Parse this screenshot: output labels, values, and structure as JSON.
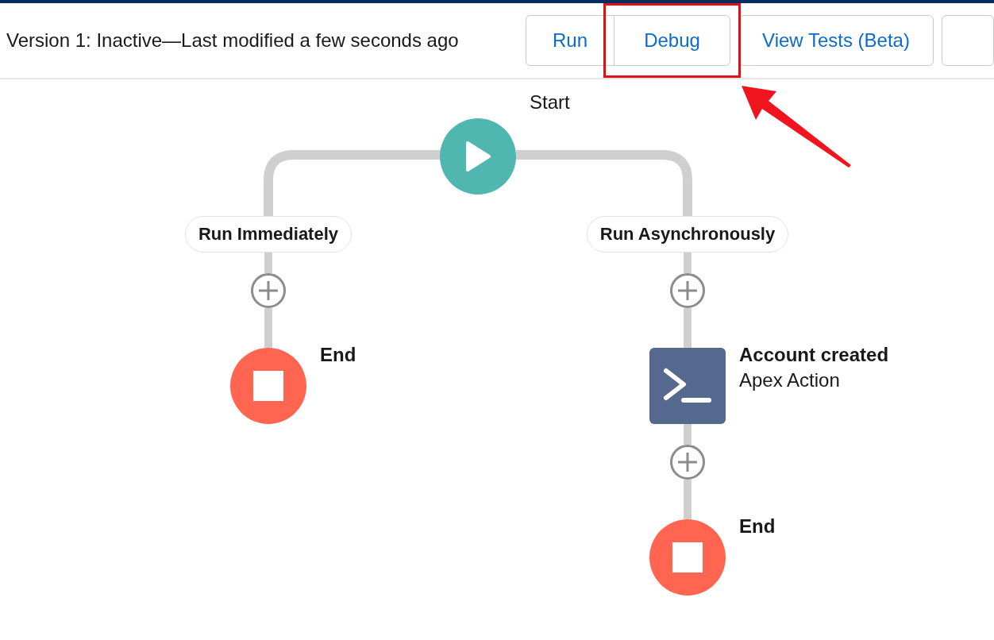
{
  "toolbar": {
    "version_status": "Version 1: Inactive—Last modified a few seconds ago",
    "buttons": [
      {
        "label": "Run",
        "highlighted": false
      },
      {
        "label": "Debug",
        "highlighted": true
      },
      {
        "label": "View Tests (Beta)",
        "highlighted": false
      }
    ]
  },
  "flow": {
    "start": {
      "label": "Start"
    },
    "branches": [
      {
        "label": "Run Immediately",
        "elements": [
          {
            "kind": "end",
            "label": "End"
          }
        ]
      },
      {
        "label": "Run Asynchronously",
        "elements": [
          {
            "kind": "action",
            "title": "Account created",
            "subtitle": "Apex Action"
          },
          {
            "kind": "end",
            "label": "End"
          }
        ]
      }
    ]
  }
}
